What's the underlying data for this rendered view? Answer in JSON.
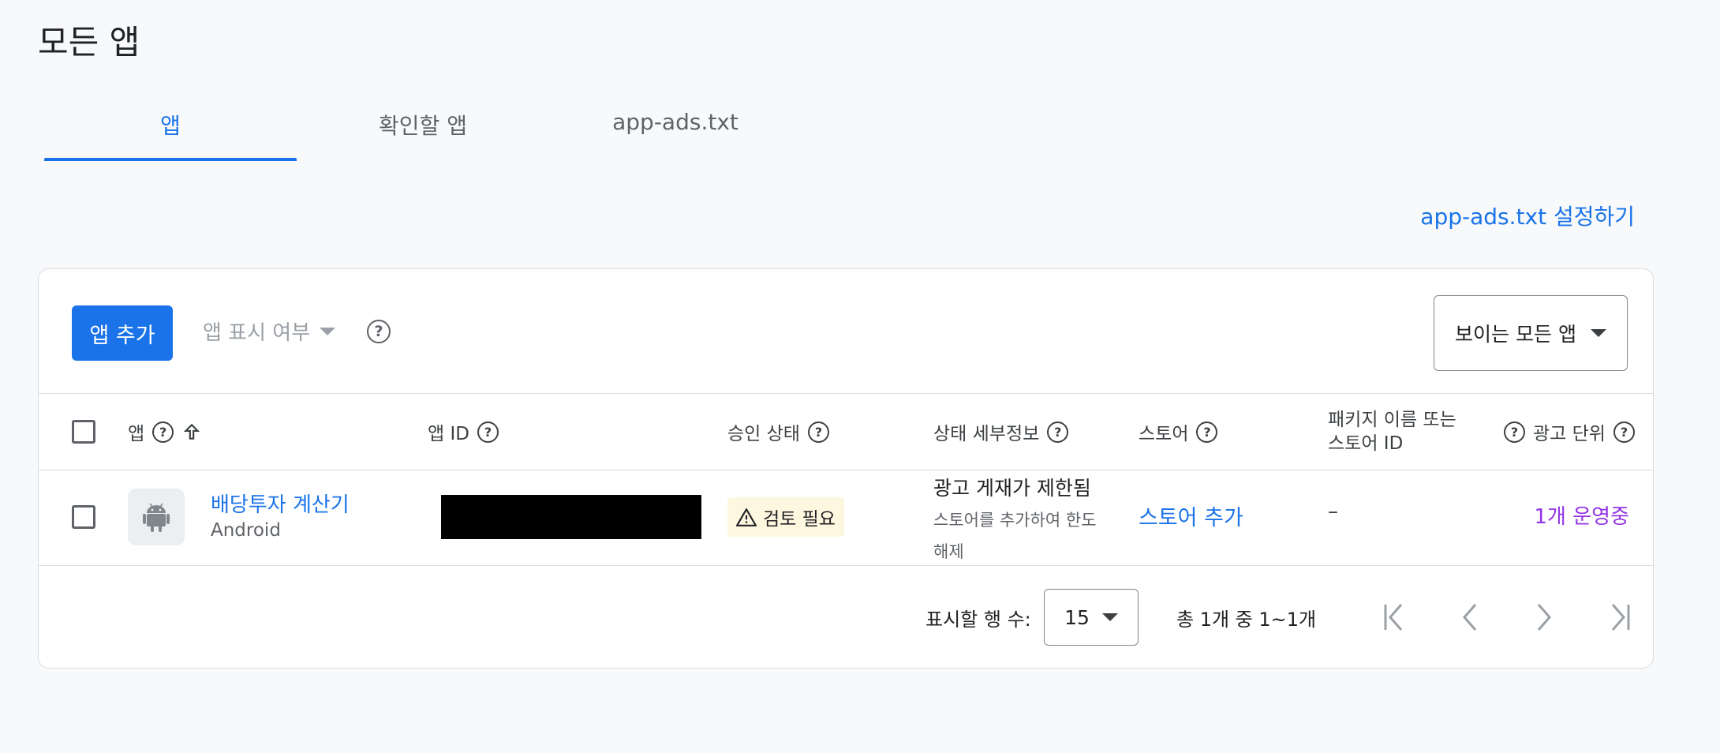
{
  "page": {
    "title": "모든 앱"
  },
  "tabs": [
    {
      "label": "앱",
      "active": true
    },
    {
      "label": "확인할 앱",
      "active": false
    },
    {
      "label": "app-ads.txt",
      "active": false
    }
  ],
  "setup_link": "app-ads.txt 설정하기",
  "toolbar": {
    "add_button": "앱 추가",
    "visibility_label": "앱 표시 여부",
    "filter_value": "보이는 모든 앱"
  },
  "table": {
    "columns": [
      {
        "label": "앱",
        "help": true,
        "sort": "ascending"
      },
      {
        "label": "앱 ID",
        "help": true
      },
      {
        "label": "승인 상태",
        "help": true
      },
      {
        "label": "상태 세부정보",
        "help": true
      },
      {
        "label": "스토어",
        "help": true
      },
      {
        "label": "패키지 이름 또는 스토어 ID",
        "help": true
      },
      {
        "label": "광고 단위",
        "help": true
      }
    ],
    "rows": [
      {
        "app_name": "배당투자 계산기",
        "platform": "Android",
        "app_id": "",
        "approval_status": "검토 필요",
        "status_title": "광고 게재가 제한됨",
        "status_desc": "스토어를 추가하여 한도 해제",
        "store": "스토어 추가",
        "package": "–",
        "ad_units": "1개 운영중"
      }
    ]
  },
  "pagination": {
    "rows_label": "표시할 행 수:",
    "rows_per_page": "15",
    "range": "총 1개 중 1~1개"
  },
  "colors": {
    "accent": "#1a73e8",
    "warning_chip_bg": "#fef7e0",
    "ad_units_link": "#9334e6"
  },
  "icons": [
    "help-icon",
    "sort-up-arrow-icon",
    "android-icon",
    "warning-icon",
    "caret-down-icon",
    "first-page-icon",
    "prev-page-icon",
    "next-page-icon",
    "last-page-icon"
  ]
}
